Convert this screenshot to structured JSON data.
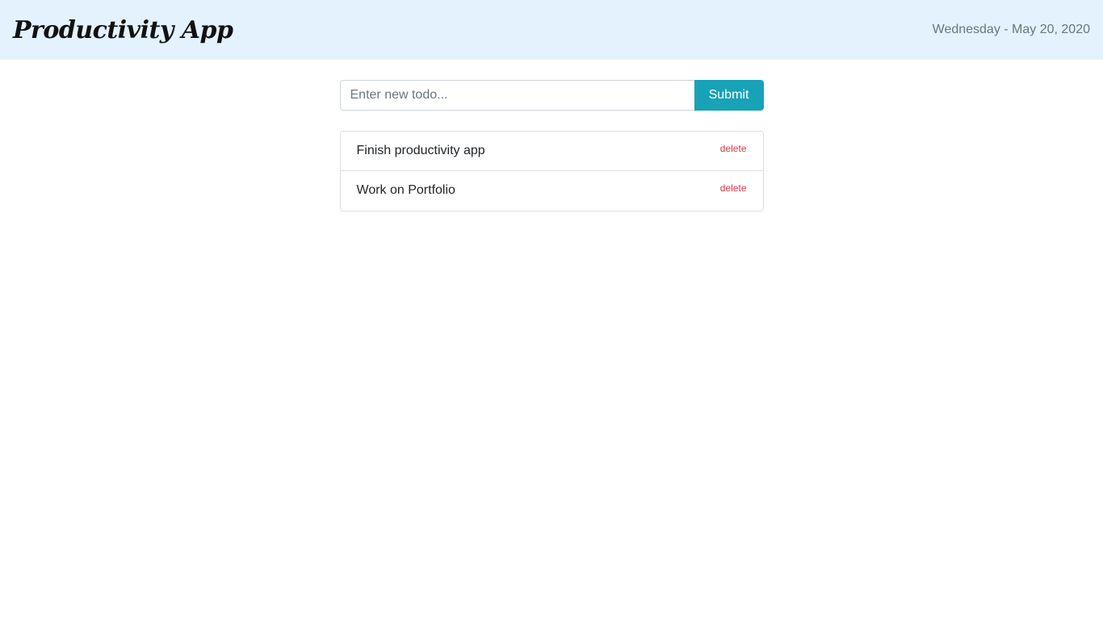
{
  "header": {
    "brand": "Productivity App",
    "date": "Wednesday - May 20, 2020"
  },
  "form": {
    "input_value": "",
    "input_placeholder": "Enter new todo...",
    "submit_label": "Submit"
  },
  "todos": [
    {
      "text": "Finish productivity app",
      "delete_label": "delete"
    },
    {
      "text": "Work on Portfolio",
      "delete_label": "delete"
    }
  ],
  "colors": {
    "navbar_bg": "#e3f2fd",
    "submit_bg": "#17a2b8",
    "delete_text": "#dc3545"
  }
}
